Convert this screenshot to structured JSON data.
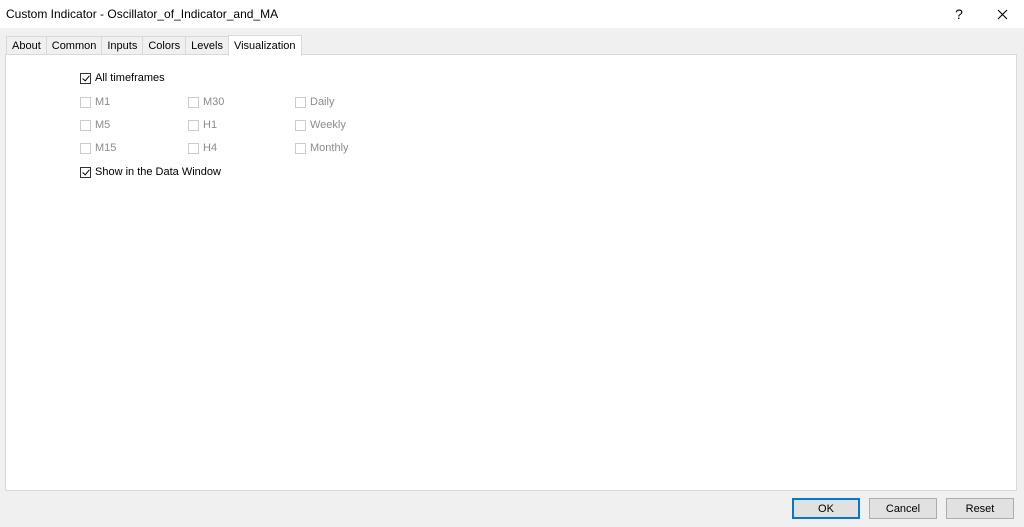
{
  "window": {
    "title": "Custom Indicator - Oscillator_of_Indicator_and_MA",
    "help_glyph": "?"
  },
  "tabs": [
    {
      "label": "About"
    },
    {
      "label": "Common"
    },
    {
      "label": "Inputs"
    },
    {
      "label": "Colors"
    },
    {
      "label": "Levels"
    },
    {
      "label": "Visualization"
    }
  ],
  "active_tab": "Visualization",
  "visualization": {
    "all_timeframes": {
      "label": "All timeframes",
      "checked": true
    },
    "timeframes": [
      {
        "label": "M1",
        "checked": false,
        "enabled": false
      },
      {
        "label": "M5",
        "checked": false,
        "enabled": false
      },
      {
        "label": "M15",
        "checked": false,
        "enabled": false
      },
      {
        "label": "M30",
        "checked": false,
        "enabled": false
      },
      {
        "label": "H1",
        "checked": false,
        "enabled": false
      },
      {
        "label": "H4",
        "checked": false,
        "enabled": false
      },
      {
        "label": "Daily",
        "checked": false,
        "enabled": false
      },
      {
        "label": "Weekly",
        "checked": false,
        "enabled": false
      },
      {
        "label": "Monthly",
        "checked": false,
        "enabled": false
      }
    ],
    "show_data_window": {
      "label": "Show in the Data Window",
      "checked": true
    }
  },
  "buttons": {
    "ok": "OK",
    "cancel": "Cancel",
    "reset": "Reset"
  },
  "colors": {
    "accent": "#0078d7",
    "disabled_text": "#8c8c8c"
  }
}
